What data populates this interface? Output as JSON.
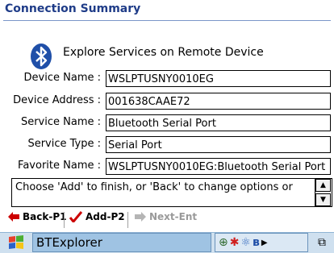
{
  "window": {
    "title": "Connection Summary"
  },
  "header": {
    "explore_text": "Explore Services on Remote Device",
    "icon": "bluetooth-icon"
  },
  "fields": [
    {
      "label": "Device Name :",
      "value": "WSLPTUSNY0010EG"
    },
    {
      "label": "Device Address :",
      "value": "001638CAAE72"
    },
    {
      "label": "Service Name :",
      "value": "Bluetooth Serial Port"
    },
    {
      "label": "Service Type :",
      "value": "Serial Port"
    },
    {
      "label": "Favorite Name :",
      "value": "WSLPTUSNY0010EG:Bluetooth Serial Port"
    }
  ],
  "status_text": "Choose 'Add' to finish, or 'Back' to change options or",
  "toolbar": {
    "back_label": "Back-P1",
    "add_label": "Add-P2",
    "next_label": "Next-Ent"
  },
  "taskbar": {
    "app_name": "BTExplorer",
    "colors": {
      "background": "#cfe0ef",
      "active_app": "#9fc3e3"
    }
  },
  "colors": {
    "title": "#1f3c88",
    "back_arrow": "#cc0000",
    "add_check": "#cc0000",
    "disabled": "#9a9a9a"
  }
}
